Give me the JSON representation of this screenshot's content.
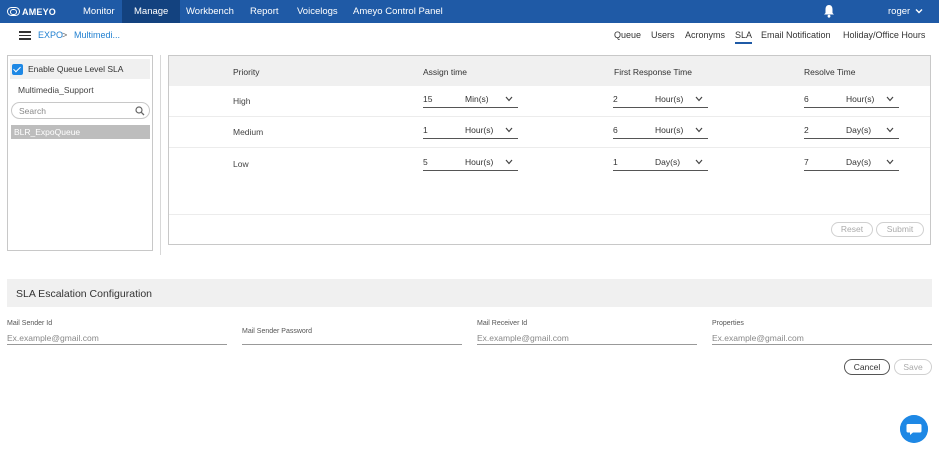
{
  "brand": {
    "name": "AMEYO"
  },
  "nav": {
    "items": [
      {
        "label": "Monitor"
      },
      {
        "label": "Manage"
      },
      {
        "label": "Workbench"
      },
      {
        "label": "Report"
      },
      {
        "label": "Voicelogs"
      },
      {
        "label": "Ameyo Control Panel"
      }
    ],
    "active": "Manage",
    "user": "roger",
    "icons": [
      "bell-icon",
      "chevron-down-icon"
    ]
  },
  "breadcrumb": {
    "root": "EXPO",
    "separator": ">",
    "current": "Multimedi..."
  },
  "tabs": {
    "items": [
      {
        "label": "Queue"
      },
      {
        "label": "Users"
      },
      {
        "label": "Acronyms"
      },
      {
        "label": "SLA"
      },
      {
        "label": "Email Notification"
      },
      {
        "label": "Holiday/Office Hours"
      }
    ],
    "active": "SLA"
  },
  "left_panel": {
    "enable_label": "Enable Queue Level SLA",
    "enabled": true,
    "queue_group": "Multimedia_Support",
    "search_placeholder": "Search",
    "queues": [
      {
        "label": "BLR_ExpoQueue",
        "selected": true
      }
    ]
  },
  "sla_table": {
    "headers": {
      "priority": "Priority",
      "assign": "Assign time",
      "first_response": "First Response Time",
      "resolve": "Resolve Time"
    },
    "rows": [
      {
        "priority": "High",
        "assign": {
          "value": "15",
          "unit": "Min(s)"
        },
        "first_response": {
          "value": "2",
          "unit": "Hour(s)"
        },
        "resolve": {
          "value": "6",
          "unit": "Hour(s)"
        }
      },
      {
        "priority": "Medium",
        "assign": {
          "value": "1",
          "unit": "Hour(s)"
        },
        "first_response": {
          "value": "6",
          "unit": "Hour(s)"
        },
        "resolve": {
          "value": "2",
          "unit": "Day(s)"
        }
      },
      {
        "priority": "Low",
        "assign": {
          "value": "5",
          "unit": "Hour(s)"
        },
        "first_response": {
          "value": "1",
          "unit": "Day(s)"
        },
        "resolve": {
          "value": "7",
          "unit": "Day(s)"
        }
      }
    ],
    "buttons": {
      "reset": "Reset",
      "submit": "Submit"
    }
  },
  "escalation": {
    "title": "SLA Escalation Configuration",
    "fields": {
      "sender_id": {
        "label": "Mail Sender Id",
        "placeholder": "Ex.example@gmail.com"
      },
      "sender_password": {
        "label": "Mail Sender Password",
        "placeholder": ""
      },
      "receiver_id": {
        "label": "Mail Receiver Id",
        "placeholder": "Ex.example@gmail.com"
      },
      "properties": {
        "label": "Properties",
        "placeholder": "Ex.example@gmail.com"
      }
    },
    "buttons": {
      "cancel": "Cancel",
      "save": "Save"
    }
  },
  "colors": {
    "nav_bg": "#1f5aa6",
    "nav_active": "#13427f",
    "accent": "#1e88e5",
    "link": "#1f7fd0"
  }
}
